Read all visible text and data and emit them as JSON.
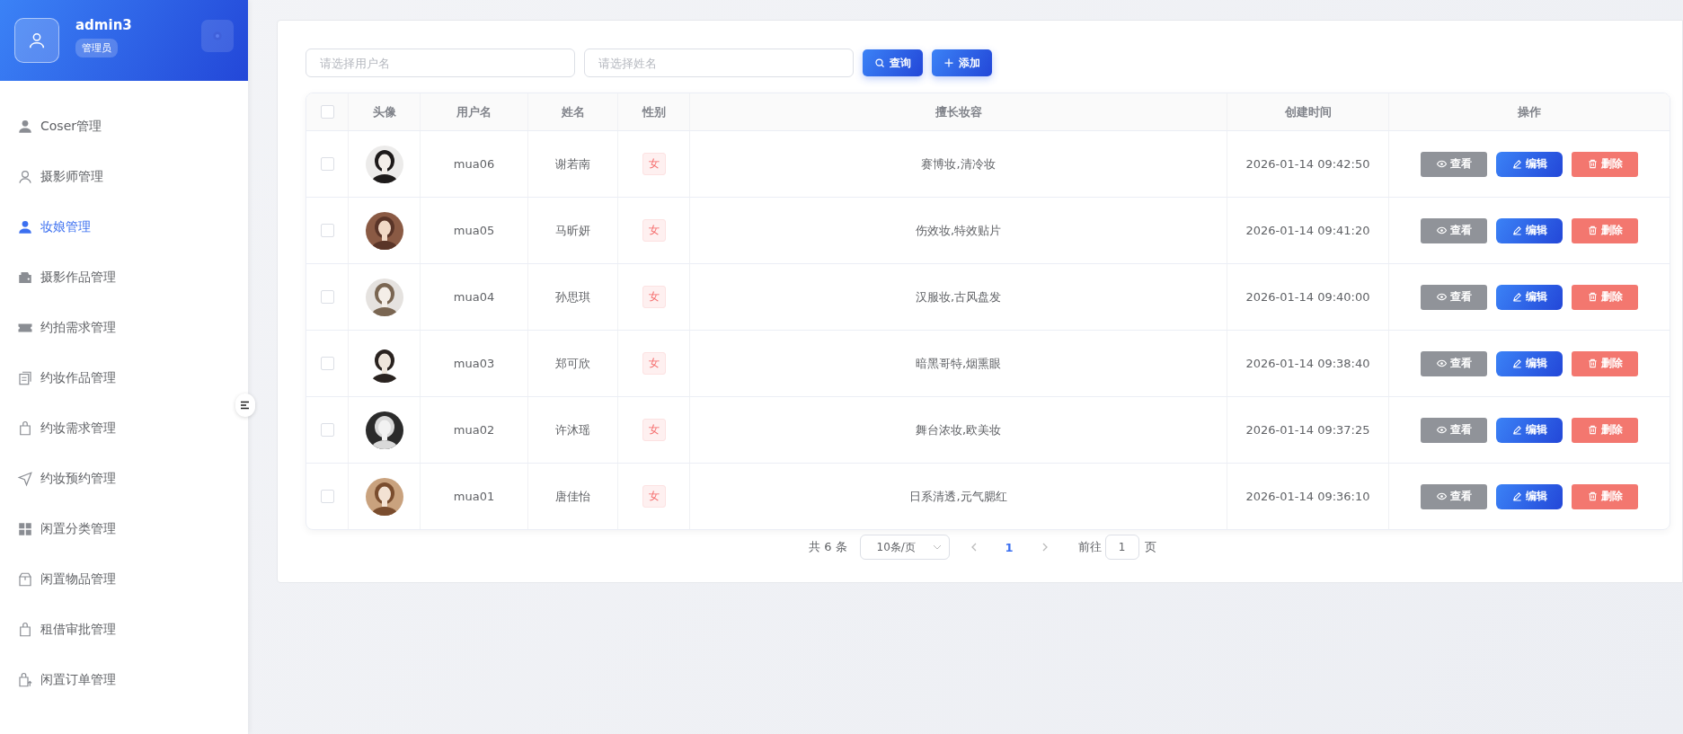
{
  "user": {
    "name": "admin3",
    "role": "管理员"
  },
  "sidebar": {
    "items": [
      {
        "label": "Coser管理",
        "selected": false
      },
      {
        "label": "摄影师管理",
        "selected": false
      },
      {
        "label": "妆娘管理",
        "selected": true
      },
      {
        "label": "摄影作品管理",
        "selected": false
      },
      {
        "label": "约拍需求管理",
        "selected": false
      },
      {
        "label": "约妆作品管理",
        "selected": false
      },
      {
        "label": "约妆需求管理",
        "selected": false
      },
      {
        "label": "约妆预约管理",
        "selected": false
      },
      {
        "label": "闲置分类管理",
        "selected": false
      },
      {
        "label": "闲置物品管理",
        "selected": false
      },
      {
        "label": "租借审批管理",
        "selected": false
      },
      {
        "label": "闲置订单管理",
        "selected": false
      }
    ]
  },
  "search": {
    "username_placeholder": "请选择用户名",
    "name_placeholder": "请选择姓名",
    "query_button": "查询",
    "add_button": "添加"
  },
  "table": {
    "select_all_checked": false,
    "columns": [
      "头像",
      "用户名",
      "姓名",
      "性别",
      "擅长妆容",
      "创建时间",
      "操作"
    ],
    "rows": [
      {
        "checked": false,
        "username": "mua06",
        "name": "谢若南",
        "gender": "女",
        "specialty": "赛博妆,清冷妆",
        "created": "2026-01-14 09:42:50",
        "actions": [
          "查看",
          "编辑",
          "删除"
        ]
      },
      {
        "checked": false,
        "username": "mua05",
        "name": "马昕妍",
        "gender": "女",
        "specialty": "伤效妆,特效贴片",
        "created": "2026-01-14 09:41:20",
        "actions": [
          "查看",
          "编辑",
          "删除"
        ]
      },
      {
        "checked": false,
        "username": "mua04",
        "name": "孙思琪",
        "gender": "女",
        "specialty": "汉服妆,古风盘发",
        "created": "2026-01-14 09:40:00",
        "actions": [
          "查看",
          "编辑",
          "删除"
        ]
      },
      {
        "checked": false,
        "username": "mua03",
        "name": "郑可欣",
        "gender": "女",
        "specialty": "暗黑哥特,烟熏眼",
        "created": "2026-01-14 09:38:40",
        "actions": [
          "查看",
          "编辑",
          "删除"
        ]
      },
      {
        "checked": false,
        "username": "mua02",
        "name": "许沐瑶",
        "gender": "女",
        "specialty": "舞台浓妆,欧美妆",
        "created": "2026-01-14 09:37:25",
        "actions": [
          "查看",
          "编辑",
          "删除"
        ]
      },
      {
        "checked": false,
        "username": "mua01",
        "name": "唐佳怡",
        "gender": "女",
        "specialty": "日系清透,元气腮红",
        "created": "2026-01-14 09:36:10",
        "actions": [
          "查看",
          "编辑",
          "删除"
        ]
      }
    ]
  },
  "pagination": {
    "total": "共 6 条",
    "page_size": "10条/页",
    "pages": [
      {
        "label": "1",
        "selected": true
      }
    ],
    "goto_label": "前往",
    "goto_value": "1",
    "page_suffix": "页"
  }
}
